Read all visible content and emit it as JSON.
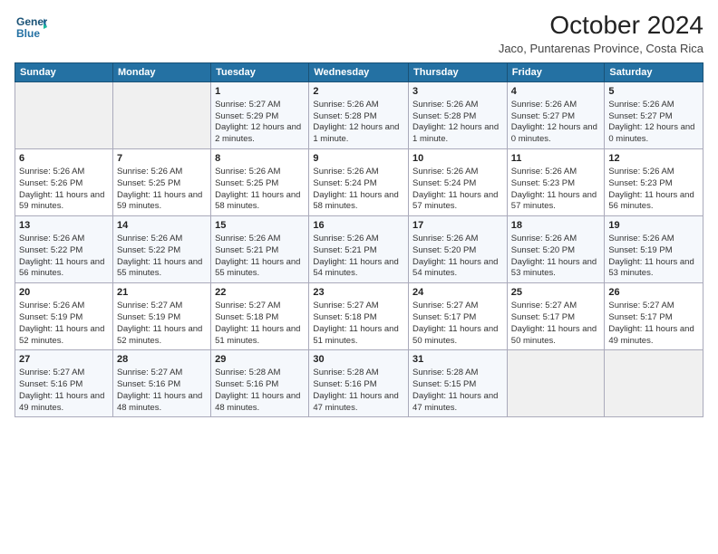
{
  "logo": {
    "line1": "General",
    "line2": "Blue"
  },
  "title": "October 2024",
  "location": "Jaco, Puntarenas Province, Costa Rica",
  "weekdays": [
    "Sunday",
    "Monday",
    "Tuesday",
    "Wednesday",
    "Thursday",
    "Friday",
    "Saturday"
  ],
  "weeks": [
    [
      {
        "day": "",
        "sunrise": "",
        "sunset": "",
        "daylight": ""
      },
      {
        "day": "",
        "sunrise": "",
        "sunset": "",
        "daylight": ""
      },
      {
        "day": "1",
        "sunrise": "Sunrise: 5:27 AM",
        "sunset": "Sunset: 5:29 PM",
        "daylight": "Daylight: 12 hours and 2 minutes."
      },
      {
        "day": "2",
        "sunrise": "Sunrise: 5:26 AM",
        "sunset": "Sunset: 5:28 PM",
        "daylight": "Daylight: 12 hours and 1 minute."
      },
      {
        "day": "3",
        "sunrise": "Sunrise: 5:26 AM",
        "sunset": "Sunset: 5:28 PM",
        "daylight": "Daylight: 12 hours and 1 minute."
      },
      {
        "day": "4",
        "sunrise": "Sunrise: 5:26 AM",
        "sunset": "Sunset: 5:27 PM",
        "daylight": "Daylight: 12 hours and 0 minutes."
      },
      {
        "day": "5",
        "sunrise": "Sunrise: 5:26 AM",
        "sunset": "Sunset: 5:27 PM",
        "daylight": "Daylight: 12 hours and 0 minutes."
      }
    ],
    [
      {
        "day": "6",
        "sunrise": "Sunrise: 5:26 AM",
        "sunset": "Sunset: 5:26 PM",
        "daylight": "Daylight: 11 hours and 59 minutes."
      },
      {
        "day": "7",
        "sunrise": "Sunrise: 5:26 AM",
        "sunset": "Sunset: 5:25 PM",
        "daylight": "Daylight: 11 hours and 59 minutes."
      },
      {
        "day": "8",
        "sunrise": "Sunrise: 5:26 AM",
        "sunset": "Sunset: 5:25 PM",
        "daylight": "Daylight: 11 hours and 58 minutes."
      },
      {
        "day": "9",
        "sunrise": "Sunrise: 5:26 AM",
        "sunset": "Sunset: 5:24 PM",
        "daylight": "Daylight: 11 hours and 58 minutes."
      },
      {
        "day": "10",
        "sunrise": "Sunrise: 5:26 AM",
        "sunset": "Sunset: 5:24 PM",
        "daylight": "Daylight: 11 hours and 57 minutes."
      },
      {
        "day": "11",
        "sunrise": "Sunrise: 5:26 AM",
        "sunset": "Sunset: 5:23 PM",
        "daylight": "Daylight: 11 hours and 57 minutes."
      },
      {
        "day": "12",
        "sunrise": "Sunrise: 5:26 AM",
        "sunset": "Sunset: 5:23 PM",
        "daylight": "Daylight: 11 hours and 56 minutes."
      }
    ],
    [
      {
        "day": "13",
        "sunrise": "Sunrise: 5:26 AM",
        "sunset": "Sunset: 5:22 PM",
        "daylight": "Daylight: 11 hours and 56 minutes."
      },
      {
        "day": "14",
        "sunrise": "Sunrise: 5:26 AM",
        "sunset": "Sunset: 5:22 PM",
        "daylight": "Daylight: 11 hours and 55 minutes."
      },
      {
        "day": "15",
        "sunrise": "Sunrise: 5:26 AM",
        "sunset": "Sunset: 5:21 PM",
        "daylight": "Daylight: 11 hours and 55 minutes."
      },
      {
        "day": "16",
        "sunrise": "Sunrise: 5:26 AM",
        "sunset": "Sunset: 5:21 PM",
        "daylight": "Daylight: 11 hours and 54 minutes."
      },
      {
        "day": "17",
        "sunrise": "Sunrise: 5:26 AM",
        "sunset": "Sunset: 5:20 PM",
        "daylight": "Daylight: 11 hours and 54 minutes."
      },
      {
        "day": "18",
        "sunrise": "Sunrise: 5:26 AM",
        "sunset": "Sunset: 5:20 PM",
        "daylight": "Daylight: 11 hours and 53 minutes."
      },
      {
        "day": "19",
        "sunrise": "Sunrise: 5:26 AM",
        "sunset": "Sunset: 5:19 PM",
        "daylight": "Daylight: 11 hours and 53 minutes."
      }
    ],
    [
      {
        "day": "20",
        "sunrise": "Sunrise: 5:26 AM",
        "sunset": "Sunset: 5:19 PM",
        "daylight": "Daylight: 11 hours and 52 minutes."
      },
      {
        "day": "21",
        "sunrise": "Sunrise: 5:27 AM",
        "sunset": "Sunset: 5:19 PM",
        "daylight": "Daylight: 11 hours and 52 minutes."
      },
      {
        "day": "22",
        "sunrise": "Sunrise: 5:27 AM",
        "sunset": "Sunset: 5:18 PM",
        "daylight": "Daylight: 11 hours and 51 minutes."
      },
      {
        "day": "23",
        "sunrise": "Sunrise: 5:27 AM",
        "sunset": "Sunset: 5:18 PM",
        "daylight": "Daylight: 11 hours and 51 minutes."
      },
      {
        "day": "24",
        "sunrise": "Sunrise: 5:27 AM",
        "sunset": "Sunset: 5:17 PM",
        "daylight": "Daylight: 11 hours and 50 minutes."
      },
      {
        "day": "25",
        "sunrise": "Sunrise: 5:27 AM",
        "sunset": "Sunset: 5:17 PM",
        "daylight": "Daylight: 11 hours and 50 minutes."
      },
      {
        "day": "26",
        "sunrise": "Sunrise: 5:27 AM",
        "sunset": "Sunset: 5:17 PM",
        "daylight": "Daylight: 11 hours and 49 minutes."
      }
    ],
    [
      {
        "day": "27",
        "sunrise": "Sunrise: 5:27 AM",
        "sunset": "Sunset: 5:16 PM",
        "daylight": "Daylight: 11 hours and 49 minutes."
      },
      {
        "day": "28",
        "sunrise": "Sunrise: 5:27 AM",
        "sunset": "Sunset: 5:16 PM",
        "daylight": "Daylight: 11 hours and 48 minutes."
      },
      {
        "day": "29",
        "sunrise": "Sunrise: 5:28 AM",
        "sunset": "Sunset: 5:16 PM",
        "daylight": "Daylight: 11 hours and 48 minutes."
      },
      {
        "day": "30",
        "sunrise": "Sunrise: 5:28 AM",
        "sunset": "Sunset: 5:16 PM",
        "daylight": "Daylight: 11 hours and 47 minutes."
      },
      {
        "day": "31",
        "sunrise": "Sunrise: 5:28 AM",
        "sunset": "Sunset: 5:15 PM",
        "daylight": "Daylight: 11 hours and 47 minutes."
      },
      {
        "day": "",
        "sunrise": "",
        "sunset": "",
        "daylight": ""
      },
      {
        "day": "",
        "sunrise": "",
        "sunset": "",
        "daylight": ""
      }
    ]
  ]
}
